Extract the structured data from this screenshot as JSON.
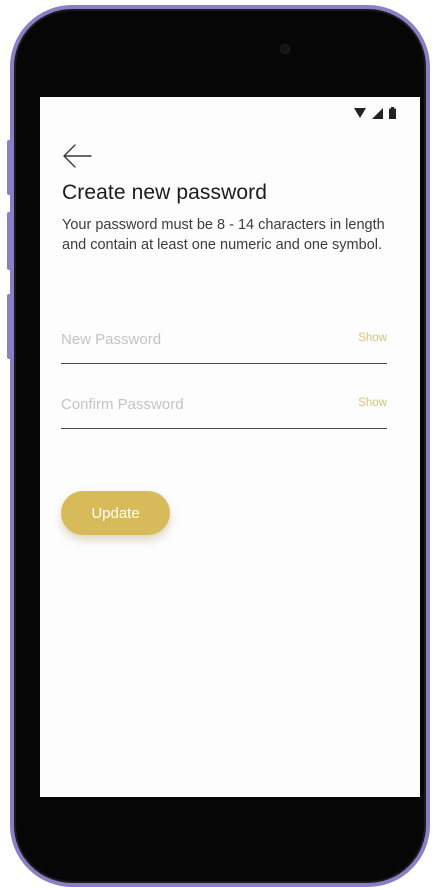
{
  "header": {
    "back_icon": "arrow-left-icon",
    "status_icons": [
      "wifi-icon",
      "signal-icon",
      "battery-icon"
    ]
  },
  "main": {
    "title": "Create new password",
    "description": "Your password must be 8 - 14 characters in length and contain at least one numeric and one symbol."
  },
  "form": {
    "new_password": {
      "placeholder": "New Password",
      "value": "",
      "toggle_label": "Show"
    },
    "confirm_password": {
      "placeholder": "Confirm Password",
      "value": "",
      "toggle_label": "Show"
    },
    "submit_label": "Update"
  },
  "colors": {
    "accent": "#d7bb5a",
    "show_text": "#d8c17a",
    "phone_frame": "#8a7fc4"
  }
}
